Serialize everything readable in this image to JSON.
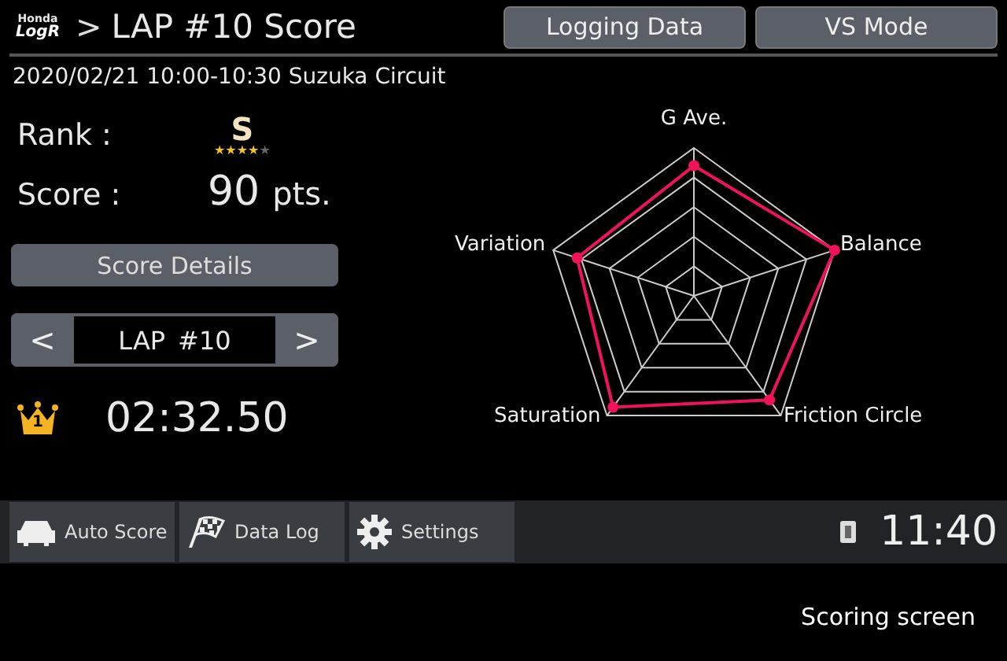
{
  "header": {
    "logo_brand": "Honda",
    "logo_name": "LogR",
    "separator": ">",
    "title": "LAP #10 Score",
    "buttons": [
      "Logging Data",
      "VS Mode"
    ]
  },
  "session": "2020/02/21 10:00-10:30 Suzuka Circuit",
  "rank": {
    "label": "Rank :",
    "value": "S",
    "stars": 4
  },
  "score": {
    "label": "Score :",
    "value": "90",
    "unit": "pts."
  },
  "details_button": "Score Details",
  "lap_selector": {
    "prev": "<",
    "label": "LAP",
    "number": "#10",
    "next": ">"
  },
  "best_time": {
    "badge": "1",
    "time": "02:32.50"
  },
  "radar_axes": [
    "G Ave.",
    "Balance",
    "Friction Circle",
    "Saturation",
    "Variation"
  ],
  "bottom_bar": {
    "items": [
      {
        "kind": "car",
        "label": "Auto Score"
      },
      {
        "kind": "flag",
        "label": "Data Log"
      },
      {
        "kind": "gear",
        "label": "Settings"
      }
    ],
    "clock": "11:40"
  },
  "caption": "Scoring screen"
}
